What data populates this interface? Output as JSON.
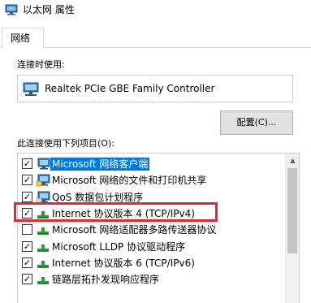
{
  "window": {
    "title": "以太网 属性"
  },
  "tabs": [
    {
      "label": "网络"
    }
  ],
  "connect_using": {
    "label": "连接时使用:",
    "adapter": "Realtek PCIe GBE Family Controller",
    "configure_button": "配置(C)..."
  },
  "items_section": {
    "label": "此连接使用下列项目(O):",
    "items": [
      {
        "label": "Microsoft 网络客户端",
        "checked": true,
        "icon": "network-client-icon",
        "selected": true
      },
      {
        "label": "Microsoft 网络的文件和打印机共享",
        "checked": true,
        "icon": "file-share-icon",
        "selected": false
      },
      {
        "label": "QoS 数据包计划程序",
        "checked": true,
        "icon": "qos-icon",
        "selected": false
      },
      {
        "label": "Internet 协议版本 4 (TCP/IPv4)",
        "checked": true,
        "icon": "protocol-icon",
        "selected": false
      },
      {
        "label": "Microsoft 网络适配器多路传送器协议",
        "checked": false,
        "icon": "protocol-icon",
        "selected": false
      },
      {
        "label": "Microsoft LLDP 协议驱动程序",
        "checked": true,
        "icon": "protocol-icon",
        "selected": false
      },
      {
        "label": "Internet 协议版本 6 (TCP/IPv6)",
        "checked": true,
        "icon": "protocol-icon",
        "selected": false
      },
      {
        "label": "链路层拓扑发现响应程序",
        "checked": true,
        "icon": "protocol-icon",
        "selected": false
      }
    ]
  },
  "colors": {
    "selection": "#0078d7",
    "highlight_border": "#e02a33",
    "protocol_green": "#2a9b3a",
    "monitor_blue": "#3b7fc4"
  }
}
